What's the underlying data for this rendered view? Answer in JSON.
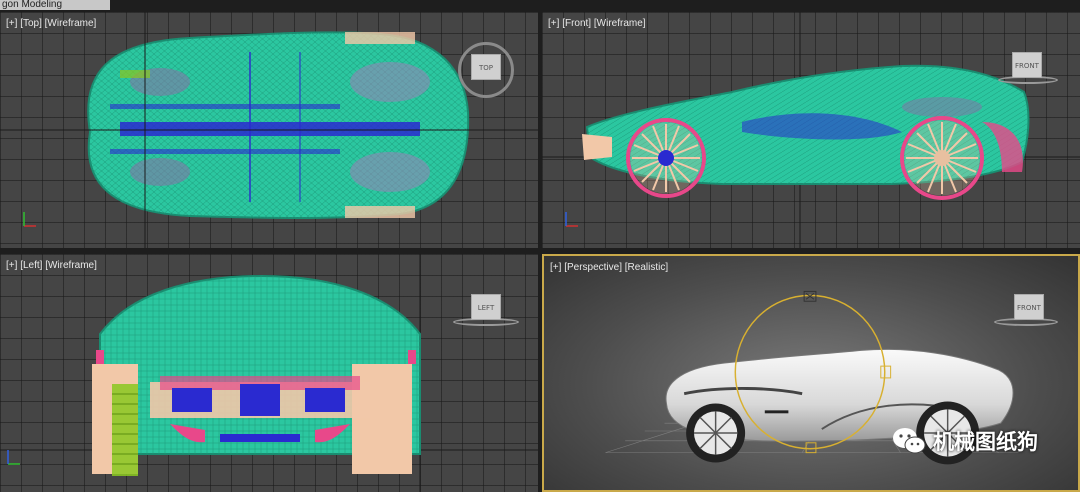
{
  "ribbon": {
    "tab_label": "gon Modeling"
  },
  "viewports": {
    "top": {
      "menu": "[+]",
      "view": "[Top]",
      "mode": "[Wireframe]",
      "cube": "TOP"
    },
    "front": {
      "menu": "[+]",
      "view": "[Front]",
      "mode": "[Wireframe]",
      "cube": "FRONT"
    },
    "left": {
      "menu": "[+]",
      "view": "[Left]",
      "mode": "[Wireframe]",
      "cube": "LEFT"
    },
    "perspective": {
      "menu": "[+]",
      "view": "[Perspective]",
      "mode": "[Realistic]",
      "cube": "FRONT"
    }
  },
  "watermark": {
    "text": "机械图纸狗",
    "icon": "wechat-icon"
  },
  "colors": {
    "wire_primary": "#2bc7a0",
    "wire_pink": "#e8488a",
    "wire_blue": "#2a2ad0",
    "wire_peach": "#f2c8a8",
    "wire_green": "#8ac820",
    "viewport_bg": "#454545",
    "active_border": "#c9a94a",
    "gizmo": "#d8b030"
  }
}
